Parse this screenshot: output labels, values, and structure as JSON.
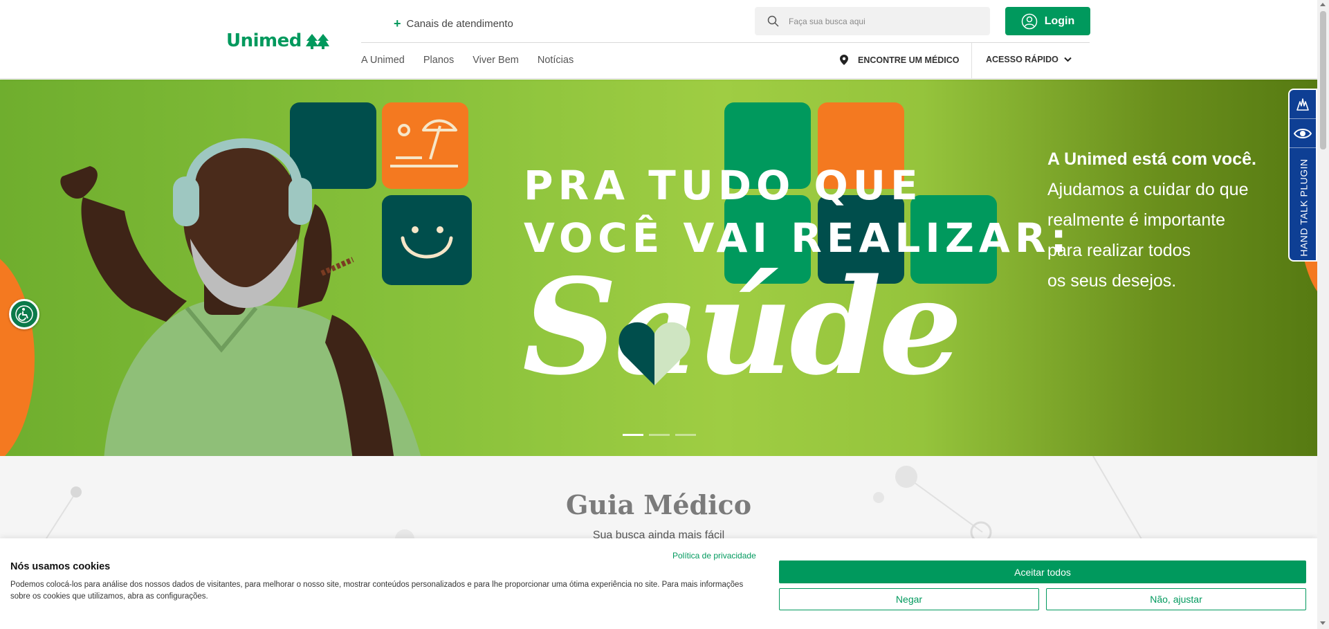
{
  "header": {
    "logo_text": "Unimed",
    "canais_label": "Canais de atendimento",
    "search": {
      "placeholder": "Faça sua busca aqui",
      "icon": "search-icon"
    },
    "login_label": "Login",
    "nav": [
      "A Unimed",
      "Planos",
      "Viver Bem",
      "Notícias"
    ],
    "find_doctor_label": "ENCONTRE UM MÉDICO",
    "quick_access_label": "ACESSO RÁPIDO"
  },
  "hero": {
    "headline_line1": "PRA TUDO QUE",
    "headline_line2": "VOCÊ VAI REALIZAR:",
    "big_word": "Saúde",
    "text_bold": "A Unimed está com você.",
    "text_lines": [
      "Ajudamos a cuidar do que",
      "realmente é importante",
      "para realizar todos",
      "os seus desejos."
    ],
    "slides_count": 3,
    "active_slide": 1
  },
  "handtalk": {
    "label": "HAND TALK PLUGIN"
  },
  "guia": {
    "title": "Guia Médico",
    "subtitle": "Sua busca ainda mais fácil"
  },
  "cookie": {
    "title": "Nós usamos cookies",
    "text": "Podemos colocá-los para análise dos nossos dados de visitantes, para melhorar o nosso site, mostrar conteúdos personalizados e para lhe proporcionar uma ótima experiência no site. Para mais informações sobre os cookies que utilizamos, abra as configurações.",
    "policy_link": "Política de privacidade",
    "accept_label": "Aceitar todos",
    "deny_label": "Negar",
    "adjust_label": "Não, ajustar"
  },
  "colors": {
    "brand_green": "#00995d",
    "dark_green": "#004e4c",
    "orange": "#f47920",
    "hand_talk_blue": "#0e3f94"
  }
}
